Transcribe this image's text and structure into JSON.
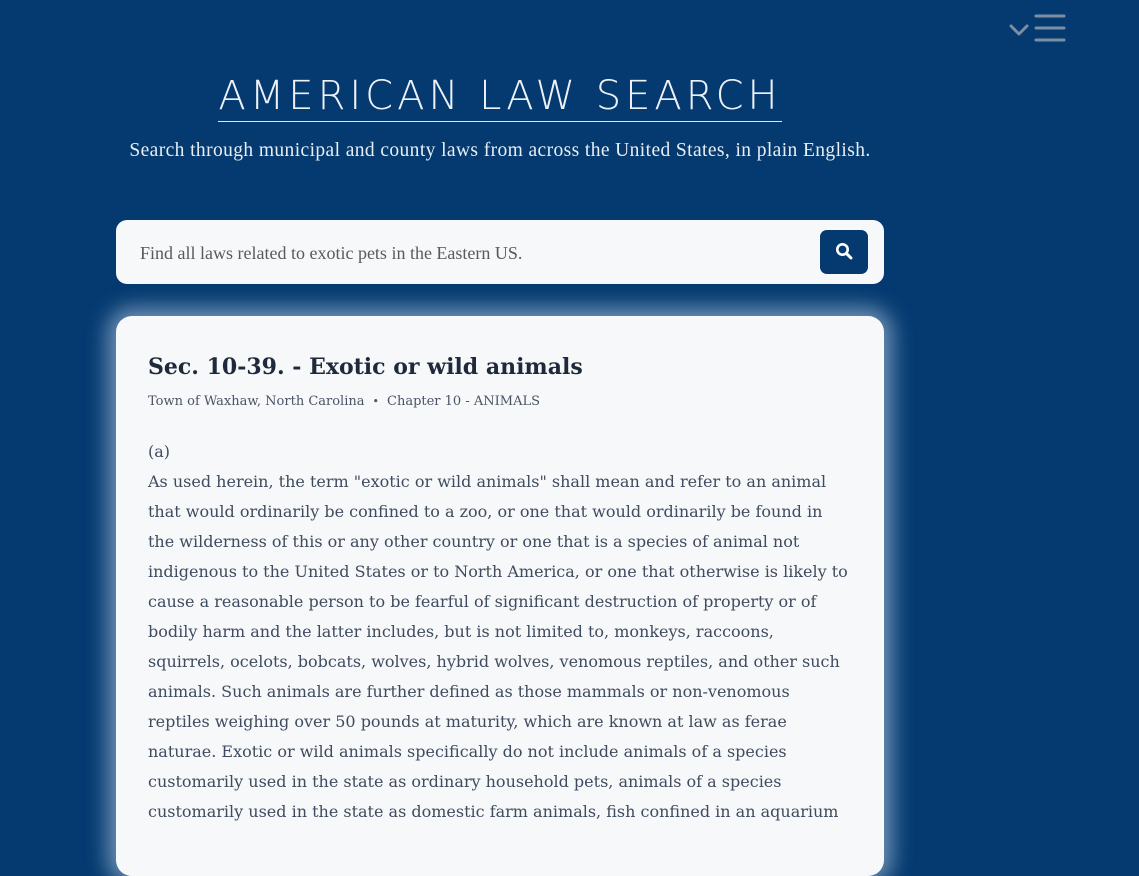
{
  "header": {
    "title": "AMERICAN LAW SEARCH",
    "tagline": "Search through municipal and county laws from across the United States, in plain English."
  },
  "search": {
    "placeholder": "Find all laws related to exotic pets in the Eastern US."
  },
  "icons": {
    "menu": "hamburger-icon",
    "dropdown": "chevron-down-icon",
    "search": "search-icon"
  },
  "colors": {
    "background": "#043a70",
    "card": "#f7f8fa",
    "accent": "#043a70"
  },
  "result": {
    "title": "Sec. 10-39. - Exotic or wild animals",
    "jurisdiction": "Town of Waxhaw, North Carolina",
    "separator": "•",
    "chapter": "Chapter 10 - ANIMALS",
    "subsection_label": "(a)",
    "text": "As used herein, the term \"exotic or wild animals\" shall mean and refer to an animal that would ordinarily be confined to a zoo, or one that would ordinarily be found in the wilderness of this or any other country or one that is a species of animal not indigenous to the United States or to North America, or one that otherwise is likely to cause a reasonable person to be fearful of significant destruction of property or of bodily harm and the latter includes, but is not limited to, monkeys, raccoons, squirrels, ocelots, bobcats, wolves, hybrid wolves, venomous reptiles, and other such animals. Such animals are further defined as those mammals or non-venomous reptiles weighing over 50 pounds at maturity, which are known at law as ferae naturae. Exotic or wild animals specifically do not include animals of a species customarily used in the state as ordinary household pets, animals of a species customarily used in the state as domestic farm animals, fish confined in an aquarium"
  }
}
